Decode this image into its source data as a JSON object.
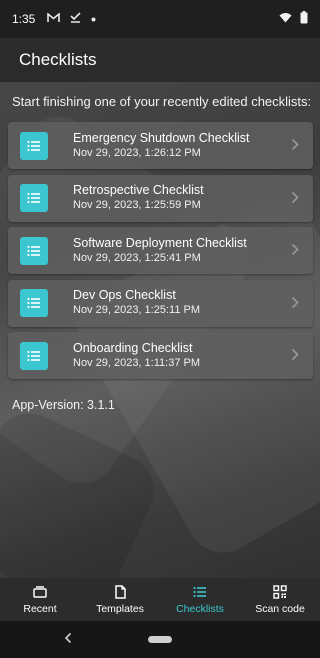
{
  "status_bar": {
    "time": "1:35",
    "icons": [
      "gmail-icon",
      "download-done-icon",
      "dot-icon",
      "wifi-icon",
      "battery-icon"
    ]
  },
  "app_bar": {
    "title": "Checklists"
  },
  "intro_text": "Start finishing one of your recently edited checklists:",
  "recent_checklists": [
    {
      "name": "Emergency Shutdown Checklist",
      "date": "Nov 29, 2023, 1:26:12 PM"
    },
    {
      "name": "Retrospective Checklist",
      "date": "Nov 29, 2023, 1:25:59 PM"
    },
    {
      "name": "Software Deployment Checklist",
      "date": "Nov 29, 2023, 1:25:41 PM"
    },
    {
      "name": "Dev Ops Checklist",
      "date": "Nov 29, 2023, 1:25:11 PM"
    },
    {
      "name": "Onboarding Checklist",
      "date": "Nov 29, 2023, 1:11:37 PM"
    }
  ],
  "app_version": "App-Version: 3.1.1",
  "bottom_nav": [
    {
      "label": "Recent",
      "icon": "recent-icon",
      "active": false
    },
    {
      "label": "Templates",
      "icon": "document-icon",
      "active": false
    },
    {
      "label": "Checklists",
      "icon": "checklist-icon",
      "active": true
    },
    {
      "label": "Scan code",
      "icon": "qr-code-icon",
      "active": false
    }
  ],
  "colors": {
    "accent": "#3cc7d0",
    "card_bg": "#5f5f5f",
    "app_bar": "#2b2b2b",
    "nav_bg": "#2c2c2c"
  }
}
